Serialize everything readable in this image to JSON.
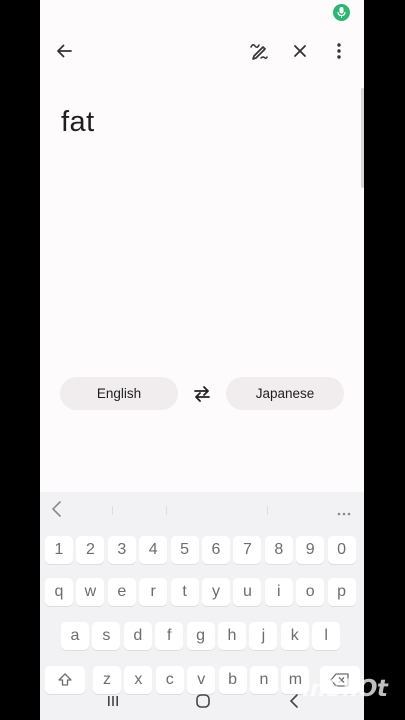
{
  "input": {
    "text": "fat"
  },
  "languages": {
    "source": "English",
    "target": "Japanese"
  },
  "keyboard": {
    "row_numbers": [
      "1",
      "2",
      "3",
      "4",
      "5",
      "6",
      "7",
      "8",
      "9",
      "0"
    ],
    "row_top": [
      "q",
      "w",
      "e",
      "r",
      "t",
      "y",
      "u",
      "i",
      "o",
      "p"
    ],
    "row_middle": [
      "a",
      "s",
      "d",
      "f",
      "g",
      "h",
      "j",
      "k",
      "l"
    ],
    "row_bottom": [
      "z",
      "x",
      "c",
      "v",
      "b",
      "n",
      "m"
    ]
  },
  "watermark": "InShOt",
  "colors": {
    "mic": "#2bb673",
    "pill": "#f1ecee",
    "background": "#fefbfc"
  }
}
